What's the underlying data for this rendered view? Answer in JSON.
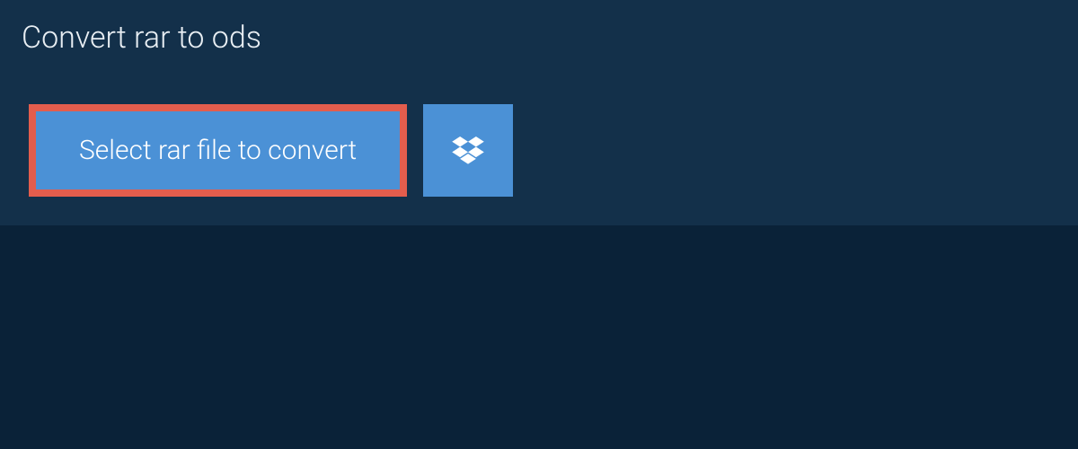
{
  "header": {
    "title": "Convert rar to ods"
  },
  "actions": {
    "select_label": "Select rar file to convert",
    "dropbox_icon": "dropbox-icon"
  },
  "colors": {
    "background": "#0a2238",
    "panel": "#13304a",
    "button": "#4b91d6",
    "highlight_border": "#e35d4d",
    "text_light": "#ffffff"
  }
}
